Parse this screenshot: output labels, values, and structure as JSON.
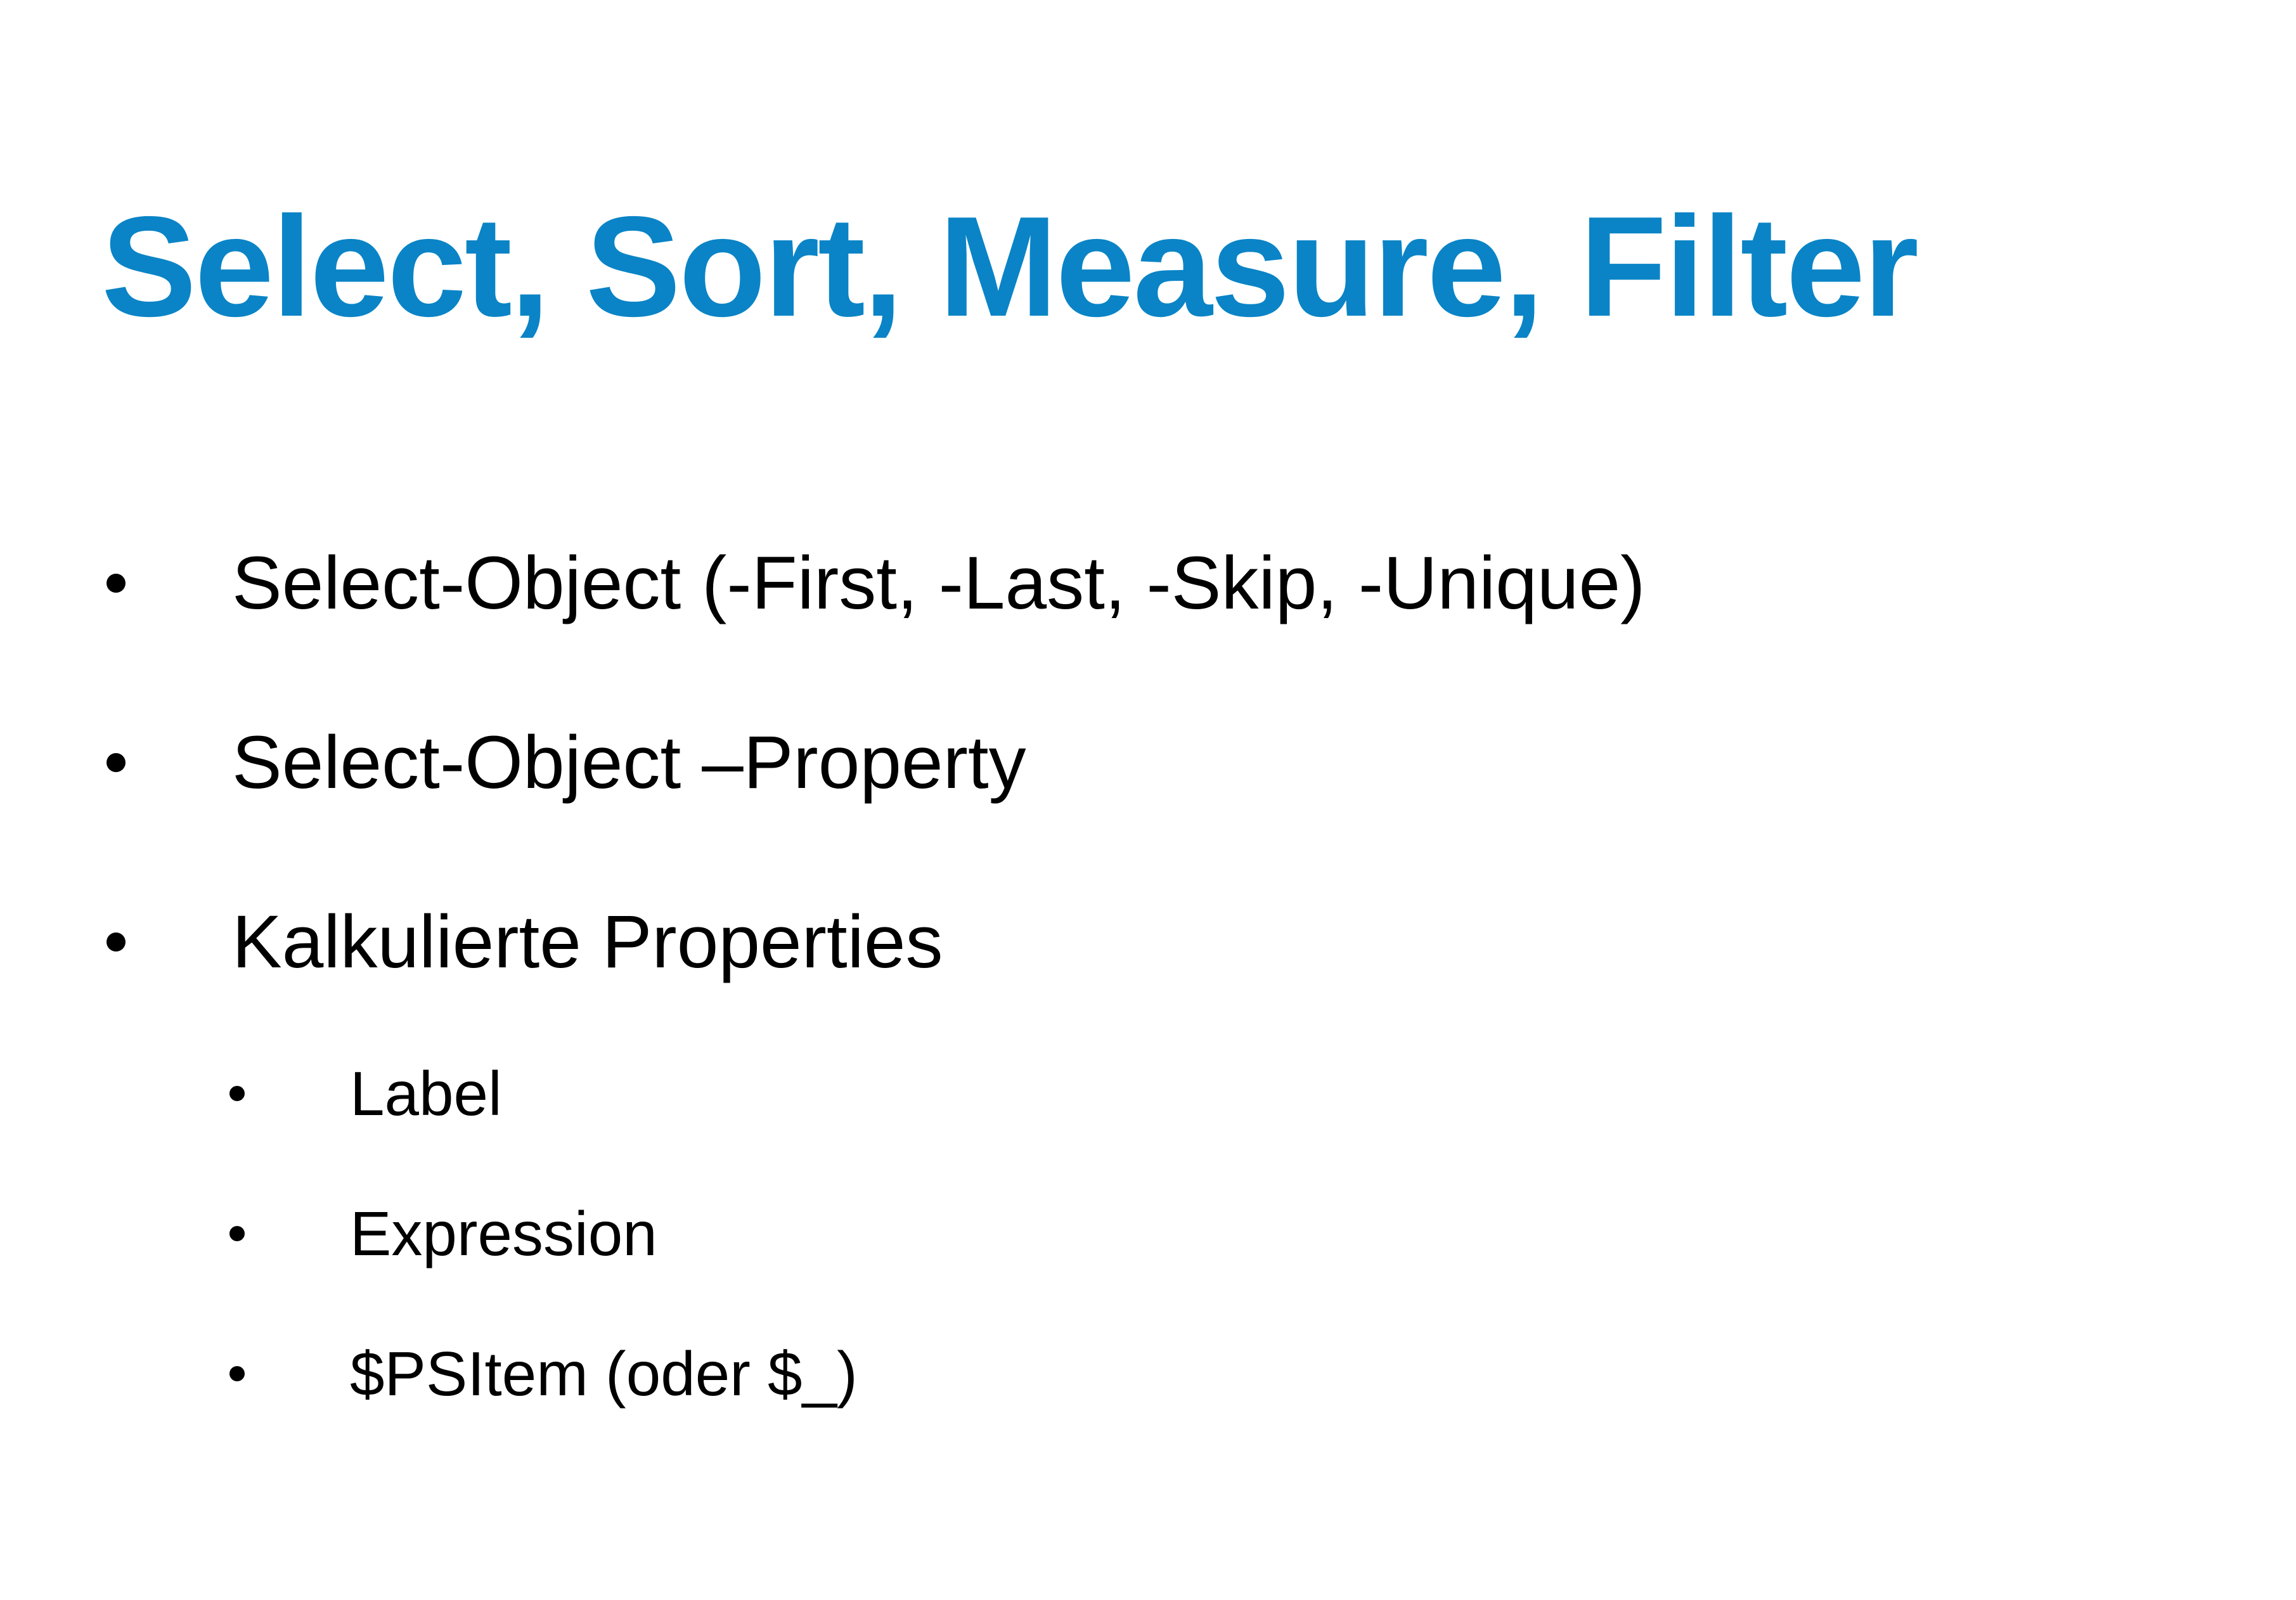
{
  "slide": {
    "title": "Select, Sort, Measure, Filter",
    "title_color": "#0a84c6",
    "text_color": "#000000",
    "bullets": [
      {
        "level": 1,
        "text": "Select-Object (-First, -Last, -Skip, -Unique)"
      },
      {
        "level": 1,
        "text": "Select-Object –Property"
      },
      {
        "level": 1,
        "text": "Kalkulierte Properties"
      },
      {
        "level": 2,
        "text": "Label"
      },
      {
        "level": 2,
        "text": "Expression"
      },
      {
        "level": 2,
        "text": "$PSItem (oder $_)"
      }
    ]
  }
}
